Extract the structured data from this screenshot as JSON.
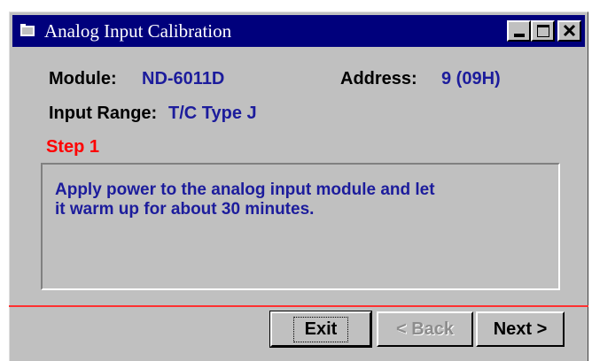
{
  "window": {
    "title": "Analog Input Calibration",
    "colors": {
      "titlebar": "#00007c",
      "face": "#c0c0c0",
      "value_text": "#1c1c9c",
      "step_text": "#ff0000"
    }
  },
  "info": {
    "module_label": "Module:",
    "module_value": "ND-6011D",
    "address_label": "Address:",
    "address_value": "9 (09H)",
    "range_label": "Input Range:",
    "range_value": "T/C Type J"
  },
  "step": {
    "label": "Step 1"
  },
  "message": {
    "line1": "Apply power to the analog input module and let",
    "line2": "it warm up for about 30 minutes."
  },
  "buttons": {
    "exit": "Exit",
    "back": "< Back",
    "next": "Next >"
  },
  "icons": [
    "app-icon",
    "minimize-icon",
    "maximize-icon",
    "close-icon"
  ]
}
